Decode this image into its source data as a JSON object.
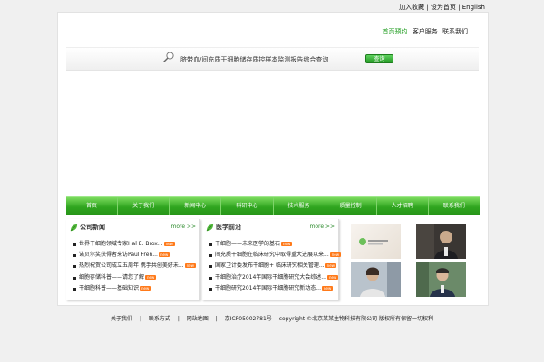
{
  "top_links": {
    "a": "加入收藏",
    "sep1": " | ",
    "b": "设为首页",
    "sep2": " | ",
    "c": "English"
  },
  "header_links": [
    {
      "label": "首页预约"
    },
    {
      "label": "客户服务"
    },
    {
      "label": "联系我们"
    }
  ],
  "search": {
    "icon": "magnifier-icon",
    "text": "脐带血/间充质干细胞储存质控样本监测报告综合查询",
    "button": "查询"
  },
  "nav": [
    {
      "label": "首页"
    },
    {
      "label": "关于我们"
    },
    {
      "label": "新闻中心"
    },
    {
      "label": "科研中心"
    },
    {
      "label": "技术服务"
    },
    {
      "label": "质量控制"
    },
    {
      "label": "人才招聘"
    },
    {
      "label": "联系我们"
    }
  ],
  "panels": {
    "company_news": {
      "title": "公司新闻",
      "more": "more >>",
      "items": [
        {
          "text": "世界干细胞领域专家Hal E. Brox...",
          "badge": "new"
        },
        {
          "text": "诺贝尔奖获得者来访Paul Fren...",
          "badge": "new"
        },
        {
          "text": "热烈祝贺公司成立五周年 携手共创美好未...",
          "badge": "new"
        },
        {
          "text": "细胞存储科普——请您了解",
          "badge": "new"
        },
        {
          "text": "干细胞科普——基础知识",
          "badge": "new"
        }
      ]
    },
    "medical_frontier": {
      "title": "医学前沿",
      "more": "more >>",
      "items": [
        {
          "text": "干细胞——未来医学的基石",
          "badge": "new"
        },
        {
          "text": "间充质干细胞在临床研究中取得重大进展以来...",
          "badge": "new"
        },
        {
          "text": "国家卫计委发布干细胞+ 临床研究相关管理...",
          "badge": "new"
        },
        {
          "text": "干细胞治疗2014年国际干细胞研究大会综述...",
          "badge": "new"
        },
        {
          "text": "干细胞研究2014年国际干细胞研究新动态...",
          "badge": "new"
        }
      ]
    }
  },
  "footer": {
    "a": "关于我们",
    "sep": "|",
    "b": "联系方式",
    "c": "网站地图",
    "icp": "京ICP05002781号",
    "copyright": "copyright ©北京某某生物科技有限公司 版权所有保留一切权利"
  },
  "colors": {
    "accent": "#2fa51f",
    "nav_top": "#7bdc5e",
    "badge": "#ff7a1a"
  }
}
